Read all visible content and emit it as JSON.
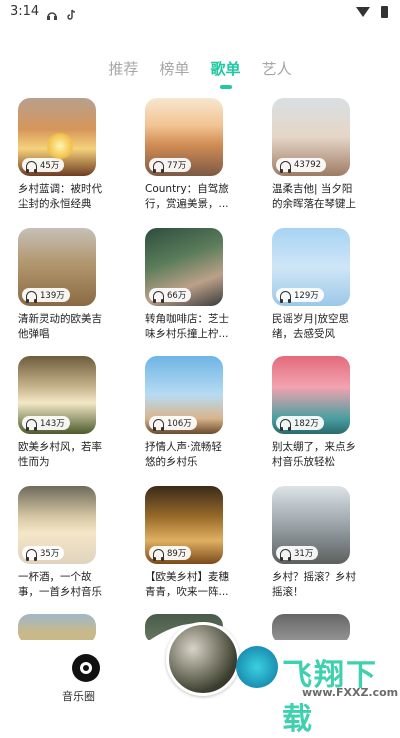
{
  "status": {
    "time": "3:14"
  },
  "tabs": [
    {
      "label": "推荐",
      "active": false
    },
    {
      "label": "榜单",
      "active": false
    },
    {
      "label": "歌单",
      "active": true
    },
    {
      "label": "艺人",
      "active": false
    }
  ],
  "playlists": [
    {
      "count": "45万",
      "title": "乡村蓝调：被时代尘封的永恒经典"
    },
    {
      "count": "77万",
      "title": "Country：自驾旅行，赏遍美景，..."
    },
    {
      "count": "43792",
      "title": "温柔吉他| 当夕阳的余晖落在琴键上"
    },
    {
      "count": "139万",
      "title": "清新灵动的欧美吉他弹唱"
    },
    {
      "count": "66万",
      "title": "转角咖啡店：芝士味乡村乐撞上柠..."
    },
    {
      "count": "129万",
      "title": "民谣岁月|放空思绪，去感受风"
    },
    {
      "count": "143万",
      "title": "欧美乡村风，若率性而为"
    },
    {
      "count": "106万",
      "title": "抒情人声·流畅轻悠的乡村乐"
    },
    {
      "count": "182万",
      "title": "别太绷了，来点乡村音乐放轻松"
    },
    {
      "count": "35万",
      "title": "一杯酒，一个故事，一首乡村音乐"
    },
    {
      "count": "89万",
      "title": "【欧美乡村】麦穗青青，吹来一阵..."
    },
    {
      "count": "31万",
      "title": "乡村？摇滚？乡村摇滚！"
    }
  ],
  "bottom_nav": {
    "music_circle_label": "音乐圈"
  },
  "watermark": {
    "brand": "飞翔下载",
    "url": "www.FXXZ.com"
  },
  "colors": {
    "accent": "#23c7a3"
  }
}
